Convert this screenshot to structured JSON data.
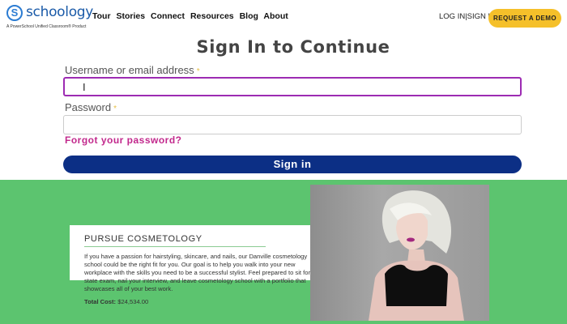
{
  "header": {
    "logo_text": "schoology",
    "logo_letter": "S",
    "logo_tagline": "A PowerSchool Unified Classroom® Product",
    "nav": [
      "Tour",
      "Stories",
      "Connect",
      "Resources",
      "Blog",
      "About"
    ],
    "login_label": "LOG IN",
    "separator": "|",
    "signup_label": "SIGN UP",
    "demo_button": "REQUEST A DEMO"
  },
  "signin": {
    "title": "Sign In to Continue",
    "username_label": "Username or email address",
    "username_value": "I",
    "password_label": "Password",
    "required_mark": "*",
    "forgot_link": "Forgot your password?",
    "submit_button": "Sign in"
  },
  "promo": {
    "title": "PURSUE COSMETOLOGY",
    "body": "If you have a passion for hairstyling, skincare, and nails, our Danville cosmetology school could be the right fit for you. Our goal is to help you walk into your new workplace with the skills you need to be a successful stylist. Feel prepared to sit for the state exam, nail your interview, and leave cosmetology school with a portfolio that showcases all of your best work.",
    "cost_label": "Total Cost:",
    "cost_value": "$24,534.00"
  },
  "colors": {
    "brand_blue": "#1a5aa8",
    "demo_yellow": "#f5c02a",
    "signin_navy": "#0c2f85",
    "forgot_magenta": "#c2288c",
    "focus_purple": "#9d2bb3",
    "promo_green": "#5cc46f"
  }
}
